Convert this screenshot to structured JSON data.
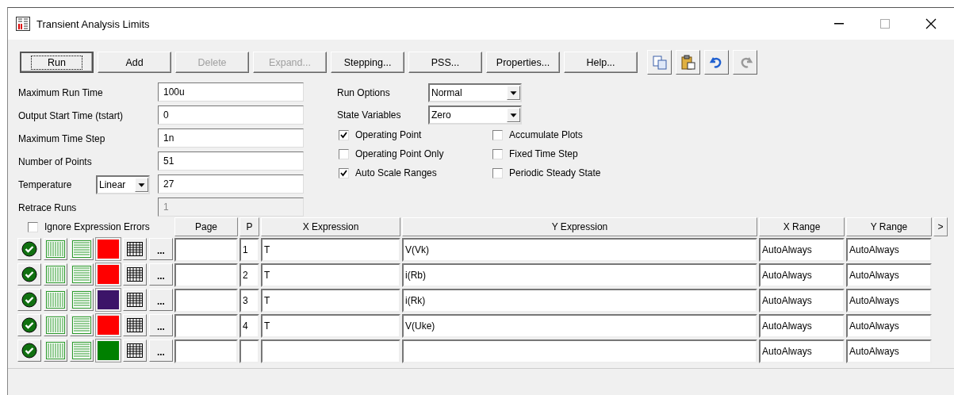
{
  "window": {
    "title": "Transient Analysis Limits"
  },
  "toolbar": {
    "buttons": [
      {
        "label": "Run",
        "disabled": false,
        "focused": true
      },
      {
        "label": "Add",
        "disabled": false,
        "focused": false
      },
      {
        "label": "Delete",
        "disabled": true,
        "focused": false
      },
      {
        "label": "Expand...",
        "disabled": true,
        "focused": false
      },
      {
        "label": "Stepping...",
        "disabled": false,
        "focused": false
      },
      {
        "label": "PSS...",
        "disabled": false,
        "focused": false
      },
      {
        "label": "Properties...",
        "disabled": false,
        "focused": false
      },
      {
        "label": "Help...",
        "disabled": false,
        "focused": false
      }
    ],
    "icon_buttons": [
      {
        "kind": "copy",
        "disabled": false
      },
      {
        "kind": "paste",
        "disabled": false
      },
      {
        "kind": "undo",
        "disabled": false
      },
      {
        "kind": "redo",
        "disabled": true
      }
    ]
  },
  "limits": [
    {
      "label": "Maximum Run Time",
      "value": "100u",
      "disabled": false
    },
    {
      "label": "Output Start Time (tstart)",
      "value": "0",
      "disabled": false
    },
    {
      "label": "Maximum Time Step",
      "value": "1n",
      "disabled": false
    },
    {
      "label": "Number of Points",
      "value": "51",
      "disabled": false
    },
    {
      "label": "Temperature",
      "mode": "Linear",
      "value": "27",
      "disabled": false
    },
    {
      "label": "Retrace Runs",
      "value": "1",
      "disabled": true
    }
  ],
  "options": [
    {
      "label": "Run Options",
      "value": "Normal"
    },
    {
      "label": "State Variables",
      "value": "Zero"
    }
  ],
  "checkboxes": [
    [
      {
        "label": "Operating Point",
        "checked": true
      },
      {
        "label": "Operating Point Only",
        "checked": false
      },
      {
        "label": "Auto Scale Ranges",
        "checked": true
      }
    ],
    [
      {
        "label": "Accumulate Plots",
        "checked": false
      },
      {
        "label": "Fixed Time Step",
        "checked": false
      },
      {
        "label": "Periodic Steady State",
        "checked": false
      }
    ]
  ],
  "ignore_errors": {
    "label": "Ignore Expression Errors",
    "checked": false
  },
  "table": {
    "row_button": "...",
    "columns": [
      "Page",
      "P",
      "X Expression",
      "Y Expression",
      "X Range",
      "Y Range"
    ],
    "more": ">",
    "rows": [
      {
        "enabled": true,
        "color": "#ff0000",
        "p": "1",
        "x": "T",
        "y": "V(Vk)",
        "xrange": "AutoAlways",
        "yrange": "AutoAlways"
      },
      {
        "enabled": true,
        "color": "#ff0000",
        "p": "2",
        "x": "T",
        "y": "i(Rb)",
        "xrange": "AutoAlways",
        "yrange": "AutoAlways"
      },
      {
        "enabled": true,
        "color": "#3c1468",
        "p": "3",
        "x": "T",
        "y": "i(Rk)",
        "xrange": "AutoAlways",
        "yrange": "AutoAlways"
      },
      {
        "enabled": true,
        "color": "#ff0000",
        "p": "4",
        "x": "T",
        "y": "V(Uke)",
        "xrange": "AutoAlways",
        "yrange": "AutoAlways"
      },
      {
        "enabled": true,
        "color": "#008000",
        "xrange": "AutoAlways",
        "yrange": "AutoAlways"
      }
    ]
  }
}
